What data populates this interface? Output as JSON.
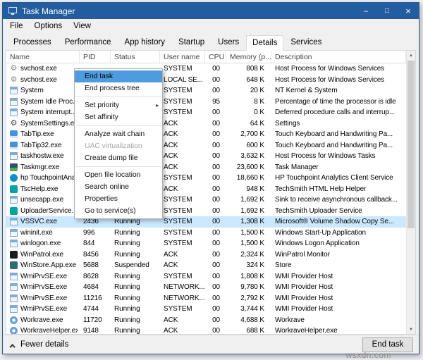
{
  "window": {
    "title": "Task Manager",
    "controls": {
      "minimize": "–",
      "maximize": "□",
      "close": "×"
    }
  },
  "menubar": [
    "File",
    "Options",
    "View"
  ],
  "tabs": {
    "items": [
      "Processes",
      "Performance",
      "App history",
      "Startup",
      "Users",
      "Details",
      "Services"
    ],
    "active": "Details"
  },
  "table": {
    "columns": [
      {
        "key": "name",
        "label": "Name"
      },
      {
        "key": "pid",
        "label": "PID"
      },
      {
        "key": "status",
        "label": "Status"
      },
      {
        "key": "user",
        "label": "User name"
      },
      {
        "key": "cpu",
        "label": "CPU"
      },
      {
        "key": "memory",
        "label": "Memory (p..."
      },
      {
        "key": "desc",
        "label": "Description"
      }
    ],
    "rows": [
      {
        "icon": "gear-icon",
        "name": "svchost.exe",
        "pid": "",
        "status": "",
        "user": "SYSTEM",
        "cpu": "00",
        "memory": "808 K",
        "desc": "Host Process for Windows Services"
      },
      {
        "icon": "gear-icon",
        "name": "svchost.exe",
        "pid": "",
        "status": "",
        "user": "LOCAL SE...",
        "cpu": "00",
        "memory": "648 K",
        "desc": "Host Process for Windows Services"
      },
      {
        "icon": "system-icon",
        "name": "System",
        "pid": "",
        "status": "",
        "user": "SYSTEM",
        "cpu": "00",
        "memory": "20 K",
        "desc": "NT Kernel & System"
      },
      {
        "icon": "system-icon",
        "name": "System Idle Proc...",
        "pid": "",
        "status": "",
        "user": "SYSTEM",
        "cpu": "95",
        "memory": "8 K",
        "desc": "Percentage of time the processor is idle"
      },
      {
        "icon": "system-icon",
        "name": "System interrupt...",
        "pid": "",
        "status": "",
        "user": "SYSTEM",
        "cpu": "00",
        "memory": "0 K",
        "desc": "Deferred procedure calls and interrup..."
      },
      {
        "icon": "settings-gear-icon",
        "name": "SystemSettings.e...",
        "pid": "",
        "status": "",
        "user": "ACK",
        "cpu": "00",
        "memory": "64 K",
        "desc": "Settings"
      },
      {
        "icon": "keyboard-icon",
        "name": "TabTip.exe",
        "pid": "",
        "status": "",
        "user": "ACK",
        "cpu": "00",
        "memory": "2,700 K",
        "desc": "Touch Keyboard and Handwriting Pa..."
      },
      {
        "icon": "keyboard-icon",
        "name": "TabTip32.exe",
        "pid": "",
        "status": "",
        "user": "ACK",
        "cpu": "00",
        "memory": "600 K",
        "desc": "Touch Keyboard and Handwriting Pa..."
      },
      {
        "icon": "window-icon",
        "name": "taskhostw.exe",
        "pid": "",
        "status": "",
        "user": "ACK",
        "cpu": "00",
        "memory": "3,632 K",
        "desc": "Host Process for Windows Tasks"
      },
      {
        "icon": "taskmgr-icon",
        "name": "Taskmgr.exe",
        "pid": "",
        "status": "",
        "user": "ACK",
        "cpu": "00",
        "memory": "23,600 K",
        "desc": "Task Manager"
      },
      {
        "icon": "hp-icon",
        "name": "hp TouchpointAna...",
        "pid": "",
        "status": "",
        "user": "SYSTEM",
        "cpu": "00",
        "memory": "18,660 K",
        "desc": "HP Touchpoint Analytics Client Service"
      },
      {
        "icon": "techsmith-icon",
        "name": "TscHelp.exe",
        "pid": "",
        "status": "",
        "user": "ACK",
        "cpu": "00",
        "memory": "948 K",
        "desc": "TechSmith HTML Help Helper"
      },
      {
        "icon": "window-icon",
        "name": "unsecapp.exe",
        "pid": "",
        "status": "",
        "user": "SYSTEM",
        "cpu": "00",
        "memory": "1,692 K",
        "desc": "Sink to receive asynchronous callback..."
      },
      {
        "icon": "techsmith-icon",
        "name": "UploaderService...",
        "pid": "",
        "status": "",
        "user": "SYSTEM",
        "cpu": "00",
        "memory": "1,692 K",
        "desc": "TechSmith Uploader Service"
      },
      {
        "icon": "window-icon",
        "name": "VSSVC.exe",
        "pid": "2436",
        "status": "Running",
        "user": "SYSTEM",
        "cpu": "00",
        "memory": "1,308 K",
        "desc": "Microsoft® Volume Shadow Copy Se...",
        "selected": true
      },
      {
        "icon": "window-icon",
        "name": "wininit.exe",
        "pid": "996",
        "status": "Running",
        "user": "SYSTEM",
        "cpu": "00",
        "memory": "1,500 K",
        "desc": "Windows Start-Up Application"
      },
      {
        "icon": "window-icon",
        "name": "winlogon.exe",
        "pid": "844",
        "status": "Running",
        "user": "SYSTEM",
        "cpu": "00",
        "memory": "1,500 K",
        "desc": "Windows Logon Application"
      },
      {
        "icon": "winpatrol-icon",
        "name": "WinPatrol.exe",
        "pid": "8456",
        "status": "Running",
        "user": "ACK",
        "cpu": "00",
        "memory": "2,324 K",
        "desc": "WinPatrol Monitor"
      },
      {
        "icon": "store-icon",
        "name": "WinStore.App.exe",
        "pid": "5688",
        "status": "Suspended",
        "user": "ACK",
        "cpu": "00",
        "memory": "324 K",
        "desc": "Store"
      },
      {
        "icon": "window-icon",
        "name": "WmiPrvSE.exe",
        "pid": "8628",
        "status": "Running",
        "user": "SYSTEM",
        "cpu": "00",
        "memory": "1,808 K",
        "desc": "WMI Provider Host"
      },
      {
        "icon": "window-icon",
        "name": "WmiPrvSE.exe",
        "pid": "4684",
        "status": "Running",
        "user": "NETWORK...",
        "cpu": "00",
        "memory": "9,780 K",
        "desc": "WMI Provider Host"
      },
      {
        "icon": "window-icon",
        "name": "WmiPrvSE.exe",
        "pid": "11216",
        "status": "Running",
        "user": "NETWORK...",
        "cpu": "00",
        "memory": "2,792 K",
        "desc": "WMI Provider Host"
      },
      {
        "icon": "window-icon",
        "name": "WmiPrvSE.exe",
        "pid": "4744",
        "status": "Running",
        "user": "SYSTEM",
        "cpu": "00",
        "memory": "3,744 K",
        "desc": "WMI Provider Host"
      },
      {
        "icon": "workrave-icon",
        "name": "Workrave.exe",
        "pid": "11720",
        "status": "Running",
        "user": "ACK",
        "cpu": "00",
        "memory": "4,688 K",
        "desc": "Workrave"
      },
      {
        "icon": "workrave-icon",
        "name": "WorkraveHelper.exe",
        "pid": "9148",
        "status": "Running",
        "user": "ACK",
        "cpu": "00",
        "memory": "688 K",
        "desc": "WorkraveHelper.exe"
      }
    ]
  },
  "context_menu": {
    "items": [
      {
        "label": "End task",
        "state": "highlighted"
      },
      {
        "label": "End process tree"
      },
      {
        "type": "separator"
      },
      {
        "label": "Set priority",
        "submenu": true
      },
      {
        "label": "Set affinity"
      },
      {
        "type": "separator"
      },
      {
        "label": "Analyze wait chain"
      },
      {
        "label": "UAC virtualization",
        "disabled": true
      },
      {
        "label": "Create dump file"
      },
      {
        "type": "separator"
      },
      {
        "label": "Open file location"
      },
      {
        "label": "Search online"
      },
      {
        "label": "Properties"
      },
      {
        "label": "Go to service(s)"
      }
    ]
  },
  "scrollbar": {
    "up": "▲",
    "down": "▼"
  },
  "statusbar": {
    "fewer_details_label": "Fewer details",
    "end_task_label": "End task"
  },
  "watermark": "wsxdn.com",
  "colors": {
    "titlebar": "#235d9f",
    "menu_highlight": "#4f9be0",
    "row_selected": "#cbe8ff"
  }
}
